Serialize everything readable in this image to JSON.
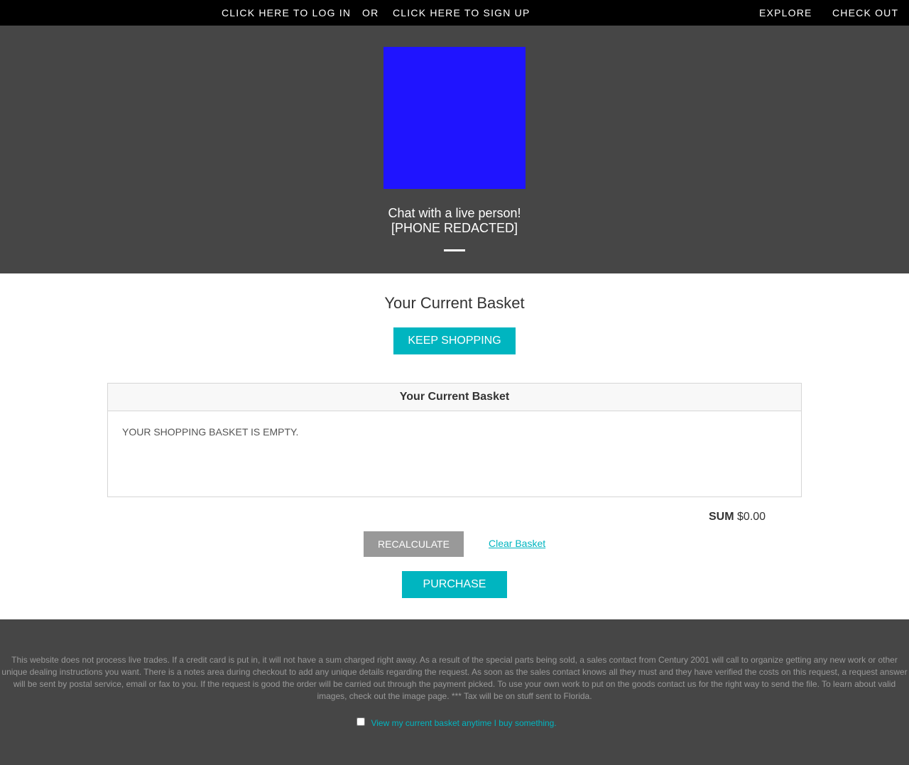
{
  "topbar": {
    "login": "CLICK HERE TO LOG IN",
    "or": "OR",
    "signup": "CLICK HERE TO SIGN UP",
    "explore": "EXPLORE",
    "checkout": "CHECK OUT"
  },
  "hero": {
    "logo_color": "#1f14ff",
    "chat": "Chat with a live person!",
    "phone": "[PHONE REDACTED]"
  },
  "main": {
    "title": "Your Current Basket",
    "keep_shopping": "KEEP SHOPPING"
  },
  "basket": {
    "header": "Your Current Basket",
    "empty": "YOUR SHOPPING BASKET IS EMPTY.",
    "sum_label": "SUM",
    "sum_value": "$0.00",
    "recalculate": "RECALCULATE",
    "clear": "Clear Basket",
    "purchase": "PURCHASE"
  },
  "footer": {
    "notice": "This website does not process live trades. If a credit card is put in, it will not have a sum charged right away. As a result of the special parts being sold, a sales contact from Century 2001 will call to organize getting any new work or other unique dealing instructions you want. There is a notes area during checkout to add any unique details regarding the request. As soon as the sales contact knows all they must and they have verified the costs on this request, a request answer will be sent by postal service, email or fax to you. If the request is good the order will be carried out through the payment picked. To use your own work to put on the goods contact us for the right way to send the file. To learn about valid images, check out the image page. *** Tax will be on stuff sent to Florida.",
    "option": "View my current basket anytime I buy something."
  },
  "colors": {
    "accent": "#00b5c0",
    "dark": "#464646",
    "topbar": "#000000",
    "button_gray": "#999999"
  }
}
